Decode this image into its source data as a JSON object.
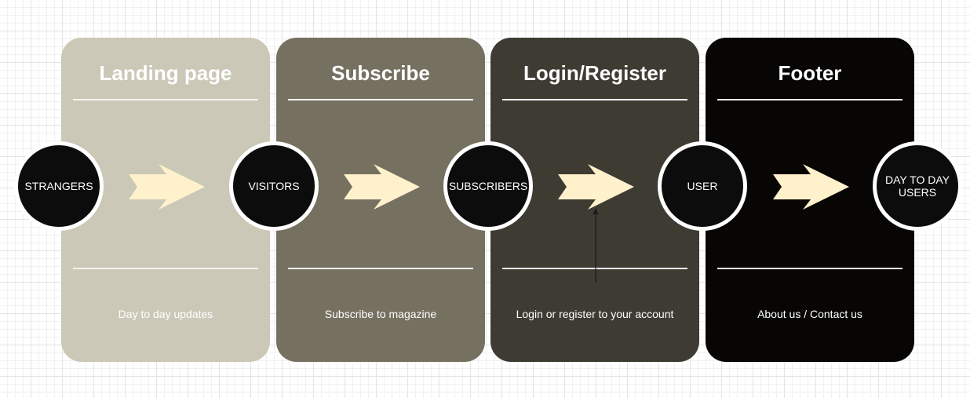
{
  "panels": [
    {
      "title": "Landing page",
      "description": "Day to day updates",
      "color": "#cbc8b7"
    },
    {
      "title": "Subscribe",
      "description": "Subscribe to magazine",
      "color": "#767061"
    },
    {
      "title": "Login/Register",
      "description": "Login or register to your account",
      "color": "#3e3b33"
    },
    {
      "title": "Footer",
      "description": "About us / Contact us",
      "color": "#070604"
    }
  ],
  "nodes": [
    {
      "label": "STRANGERS"
    },
    {
      "label": "VISITORS"
    },
    {
      "label": "SUBSCRIBERS"
    },
    {
      "label": "USER"
    },
    {
      "label": "DAY TO DAY USERS"
    }
  ],
  "colors": {
    "arrow_fill": "#fff1cc",
    "node_fill": "#0c0c0c",
    "node_border": "#ffffff",
    "connector": "#1a1a1a"
  }
}
